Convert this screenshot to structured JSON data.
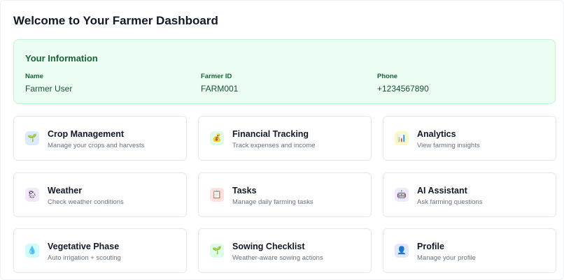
{
  "page": {
    "title": "Welcome to Your Farmer Dashboard"
  },
  "info": {
    "title": "Your Information",
    "fields": [
      {
        "label": "Name",
        "value": "Farmer User"
      },
      {
        "label": "Farmer ID",
        "value": "FARM001"
      },
      {
        "label": "Phone",
        "value": "+1234567890"
      }
    ]
  },
  "cards": [
    {
      "title": "Crop Management",
      "subtitle": "Manage your crops and harvests",
      "icon": "seedling-icon",
      "glyph": "🌱",
      "bg": "#dbeafe"
    },
    {
      "title": "Financial Tracking",
      "subtitle": "Track expenses and income",
      "icon": "money-bag-icon",
      "glyph": "💰",
      "bg": "#dcfce7"
    },
    {
      "title": "Analytics",
      "subtitle": "View farming insights",
      "icon": "bar-chart-icon",
      "glyph": "📊",
      "bg": "#fef9c3"
    },
    {
      "title": "Weather",
      "subtitle": "Check weather conditions",
      "icon": "weather-icon",
      "glyph": "🌦",
      "bg": "#f3e8ff"
    },
    {
      "title": "Tasks",
      "subtitle": "Manage daily farming tasks",
      "icon": "clipboard-icon",
      "glyph": "📋",
      "bg": "#fee2e2"
    },
    {
      "title": "AI Assistant",
      "subtitle": "Ask farming questions",
      "icon": "robot-icon",
      "glyph": "🤖",
      "bg": "#ede9fe"
    },
    {
      "title": "Vegetative Phase",
      "subtitle": "Auto irrigation + scouting",
      "icon": "droplet-icon",
      "glyph": "💧",
      "bg": "#cffafe"
    },
    {
      "title": "Sowing Checklist",
      "subtitle": "Weather-aware sowing actions",
      "icon": "sprout-icon",
      "glyph": "🌱",
      "bg": "#dcfce7"
    },
    {
      "title": "Profile",
      "subtitle": "Manage your profile",
      "icon": "user-icon",
      "glyph": "👤",
      "bg": "#e0e7ff"
    }
  ]
}
